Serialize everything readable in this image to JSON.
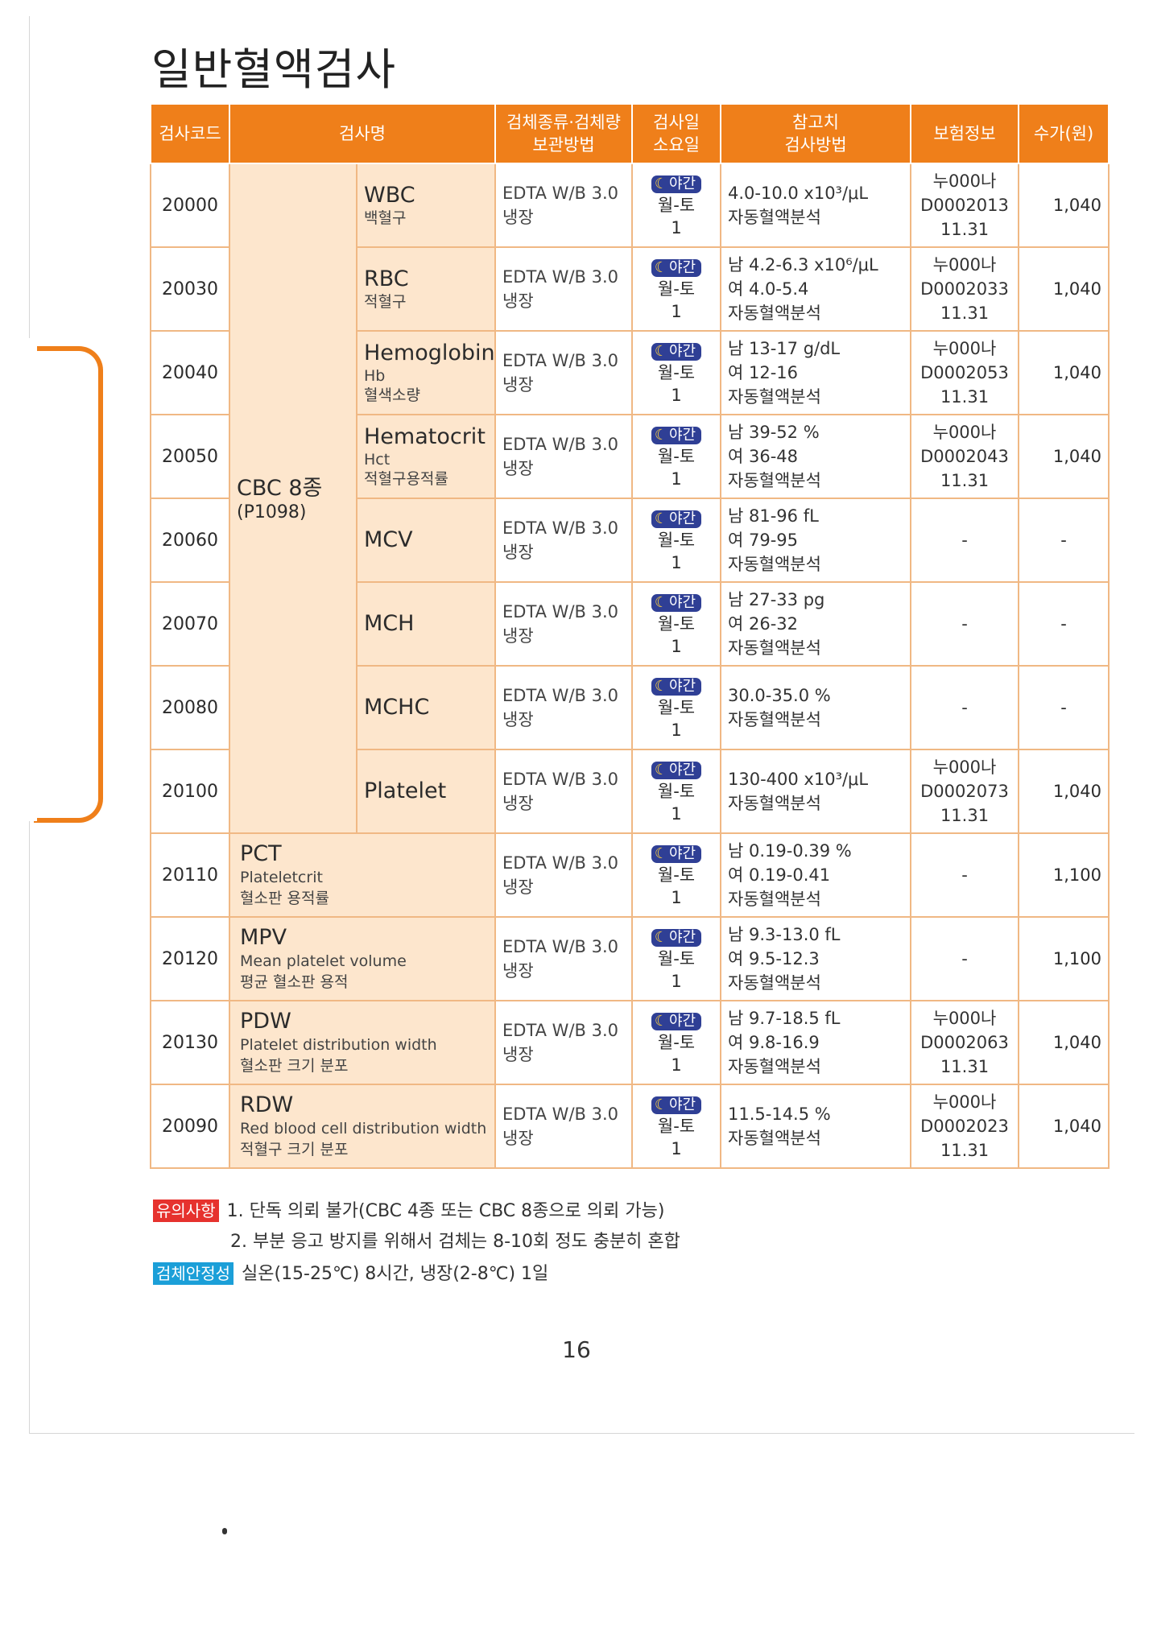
{
  "title": "일반혈액검사",
  "headers": {
    "code": "검사코드",
    "name": "검사명",
    "specimen_line1": "검체종류·검체량",
    "specimen_line2": "보관방법",
    "days_line1": "검사일",
    "days_line2": "소요일",
    "ref_line1": "참고치",
    "ref_line2": "검사방법",
    "insurance": "보험정보",
    "fee": "수가(원)"
  },
  "group": {
    "title": "CBC 8종",
    "code": "(P1098)"
  },
  "night_label": "야간",
  "specimen": {
    "type": "EDTA W/B 3.0",
    "storage": "냉장"
  },
  "schedule": {
    "days": "월-토",
    "duration": "1"
  },
  "rows": [
    {
      "code": "20000",
      "name": "WBC",
      "sub1": "백혈구",
      "sub2": "",
      "ref": [
        "4.0-10.0 x10³/μL",
        "자동혈액분석"
      ],
      "ins": [
        "누000나",
        "D0002013",
        "11.31"
      ],
      "fee": "1,040"
    },
    {
      "code": "20030",
      "name": "RBC",
      "sub1": "적혈구",
      "sub2": "",
      "ref": [
        "남 4.2-6.3 x10⁶/μL",
        "여 4.0-5.4",
        "자동혈액분석"
      ],
      "ins": [
        "누000나",
        "D0002033",
        "11.31"
      ],
      "fee": "1,040"
    },
    {
      "code": "20040",
      "name": "Hemoglobin",
      "sub1": "Hb",
      "sub2": "혈색소량",
      "ref": [
        "남 13-17 g/dL",
        "여 12-16",
        "자동혈액분석"
      ],
      "ins": [
        "누000나",
        "D0002053",
        "11.31"
      ],
      "fee": "1,040"
    },
    {
      "code": "20050",
      "name": "Hematocrit",
      "sub1": "Hct",
      "sub2": "적혈구용적률",
      "ref": [
        "남 39-52 %",
        "여 36-48",
        "자동혈액분석"
      ],
      "ins": [
        "누000나",
        "D0002043",
        "11.31"
      ],
      "fee": "1,040"
    },
    {
      "code": "20060",
      "name": "MCV",
      "sub1": "",
      "sub2": "",
      "ref": [
        "남 81-96 fL",
        "여 79-95",
        "자동혈액분석"
      ],
      "ins": [
        "-"
      ],
      "fee": "-"
    },
    {
      "code": "20070",
      "name": "MCH",
      "sub1": "",
      "sub2": "",
      "ref": [
        "남 27-33 pg",
        "여 26-32",
        "자동혈액분석"
      ],
      "ins": [
        "-"
      ],
      "fee": "-"
    },
    {
      "code": "20080",
      "name": "MCHC",
      "sub1": "",
      "sub2": "",
      "ref": [
        "30.0-35.0 %",
        "자동혈액분석"
      ],
      "ins": [
        "-"
      ],
      "fee": "-"
    },
    {
      "code": "20100",
      "name": "Platelet",
      "sub1": "",
      "sub2": "",
      "ref": [
        "130-400 x10³/μL",
        "자동혈액분석"
      ],
      "ins": [
        "누000나",
        "D0002073",
        "11.31"
      ],
      "fee": "1,040"
    },
    {
      "code": "20110",
      "name": "PCT",
      "sub1": "Plateletcrit",
      "sub2": "혈소판 용적률",
      "ref": [
        "남 0.19-0.39 %",
        "여 0.19-0.41",
        "자동혈액분석"
      ],
      "ins": [
        "-"
      ],
      "fee": "1,100"
    },
    {
      "code": "20120",
      "name": "MPV",
      "sub1": "Mean platelet volume",
      "sub2": "평균 혈소판 용적",
      "ref": [
        "남 9.3-13.0 fL",
        "여 9.5-12.3",
        "자동혈액분석"
      ],
      "ins": [
        "-"
      ],
      "fee": "1,100"
    },
    {
      "code": "20130",
      "name": "PDW",
      "sub1": "Platelet distribution width",
      "sub2": "혈소판 크기 분포",
      "ref": [
        "남 9.7-18.5 fL",
        "여 9.8-16.9",
        "자동혈액분석"
      ],
      "ins": [
        "누000나",
        "D0002063",
        "11.31"
      ],
      "fee": "1,040"
    },
    {
      "code": "20090",
      "name": "RDW",
      "sub1": "Red blood cell distribution width",
      "sub2": "적혈구 크기 분포",
      "ref": [
        "11.5-14.5 %",
        "자동혈액분석"
      ],
      "ins": [
        "누000나",
        "D0002023",
        "11.31"
      ],
      "fee": "1,040"
    }
  ],
  "notes": {
    "caution_label": "유의사항",
    "caution_lines": [
      "1. 단독 의뢰 불가(CBC 4종 또는 CBC 8종으로 의뢰 가능)",
      "2. 부분 응고 방지를 위해서 검체는 8-10회 정도 충분히 혼합"
    ],
    "stability_label": "검체안정성",
    "stability_text": "실온(15-25℃) 8시간, 냉장(2-8℃) 1일"
  },
  "page_number": "16"
}
